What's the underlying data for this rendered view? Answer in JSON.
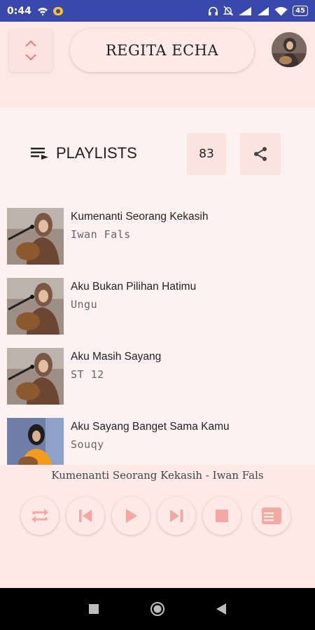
{
  "status": {
    "time": "0:44",
    "battery": "45"
  },
  "header": {
    "title": "REGITA ECHA",
    "sort_icon": "chevron-up-down-icon",
    "avatar": "artist-avatar"
  },
  "playlist": {
    "label": "PLAYLISTS",
    "count": "83",
    "share_icon": "share-icon"
  },
  "songs": [
    {
      "title": "Kumenanti Seorang Kekasih",
      "artist": "Iwan Fals"
    },
    {
      "title": "Aku Bukan Pilihan Hatimu",
      "artist": "Ungu"
    },
    {
      "title": "Aku Masih Sayang",
      "artist": "ST 12"
    },
    {
      "title": "Aku Sayang Banget Sama Kamu",
      "artist": "Souqy"
    }
  ],
  "player": {
    "now_playing": "Kumenanti Seorang Kekasih - Iwan Fals",
    "controls": [
      "repeat-icon",
      "previous-icon",
      "play-icon",
      "next-icon",
      "stop-icon",
      "queue-icon"
    ]
  },
  "colors": {
    "accent": "#f4a8a3",
    "status_bar": "#3949ab",
    "background": "#fde9e6"
  }
}
